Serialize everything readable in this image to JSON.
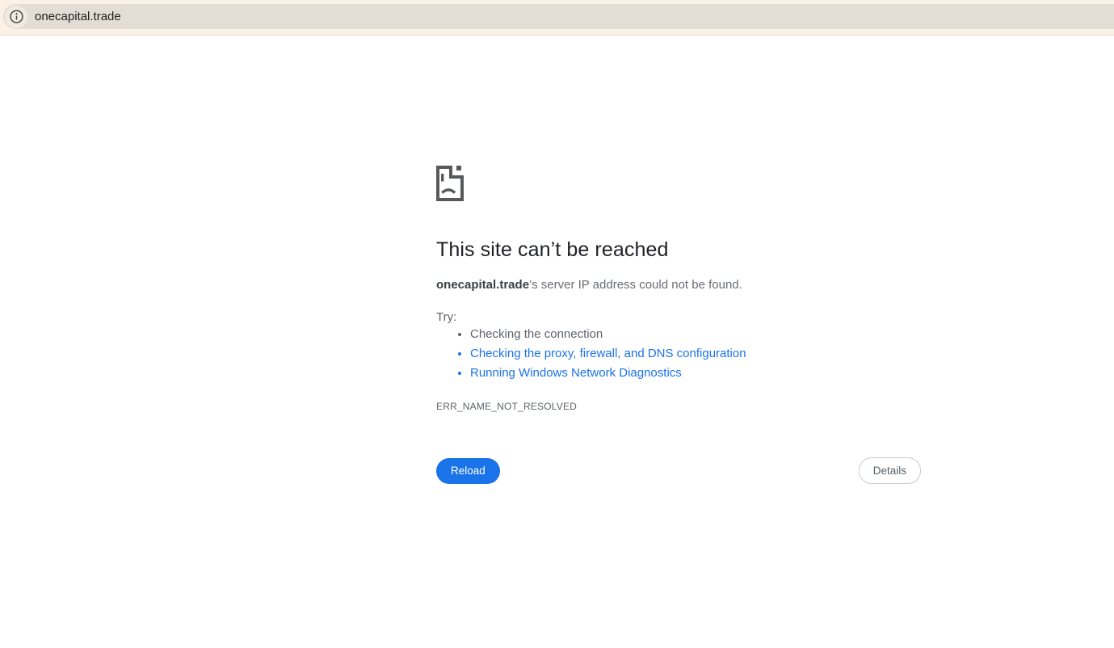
{
  "browser": {
    "url": "onecapital.trade"
  },
  "error_page": {
    "title": "This site can’t be reached",
    "domain": "onecapital.trade",
    "message_suffix": "’s server IP address could not be found.",
    "try_label": "Try:",
    "suggestions": [
      {
        "label": "Checking the connection",
        "is_link": false
      },
      {
        "label": "Checking the proxy, firewall, and DNS configuration",
        "is_link": true
      },
      {
        "label": "Running Windows Network Diagnostics",
        "is_link": true
      }
    ],
    "error_code": "ERR_NAME_NOT_RESOLVED",
    "reload_label": "Reload",
    "details_label": "Details"
  },
  "colors": {
    "topbar_background": "#faf2e7",
    "address_pill_background": "#e4ddd6",
    "link_blue": "#1a73e8",
    "reload_button_blue": "#1a73e8",
    "title_text": "#202124",
    "body_text": "#5f6368",
    "icon_gray": "#58595b"
  }
}
